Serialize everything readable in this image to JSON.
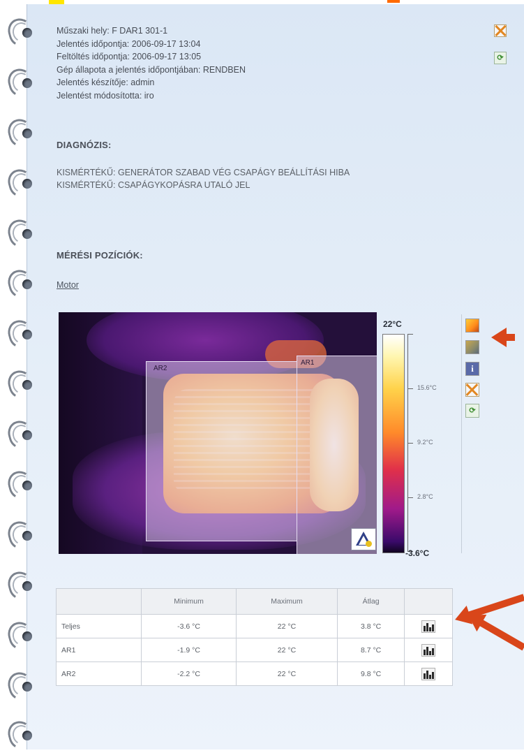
{
  "info": {
    "lines": [
      "Műszaki hely: F DAR1 301-1",
      "Jelentés időpontja: 2006-09-17 13:04",
      "Feltöltés időpontja: 2006-09-17 13:05",
      "Gép állapota a jelentés időpontjában: RENDBEN",
      "Jelentés készítője: admin",
      "Jelentést módosította: iro"
    ]
  },
  "diagnosis": {
    "heading": "DIAGNÓZIS:",
    "items": [
      "KISMÉRTÉKŰ: GENERÁTOR SZABAD VÉG CSAPÁGY BEÁLLÍTÁSI HIBA",
      "KISMÉRTÉKŰ: CSAPÁGYKOPÁSRA UTALÓ JEL"
    ]
  },
  "measurement": {
    "heading": "MÉRÉSI POZÍCIÓK:",
    "link": "Motor"
  },
  "thermal": {
    "roi_labels": [
      "AR2",
      "AR1"
    ],
    "scale_max": "22°C",
    "scale_min": "-3.6°C",
    "ticks": [
      "15.6°C",
      "9.2°C",
      "2.8°C"
    ],
    "icons": [
      "photo-icon",
      "image-icon",
      "info-icon",
      "close-icon",
      "refresh-icon",
      "warning-icon"
    ]
  },
  "table": {
    "headers": [
      "",
      "Minimum",
      "Maximum",
      "Átlag",
      ""
    ],
    "rows": [
      [
        "Teljes",
        "-3.6 °C",
        "22 °C",
        "3.8 °C"
      ],
      [
        "AR1",
        "-1.9 °C",
        "22 °C",
        "8.7 °C"
      ],
      [
        "AR2",
        "-2.2 °C",
        "22 °C",
        "9.8 °C"
      ]
    ]
  },
  "colors": {
    "arrow": "#d9461a",
    "highlight_yellow": "#ffe600",
    "page_bg": "#dbe7f5"
  }
}
